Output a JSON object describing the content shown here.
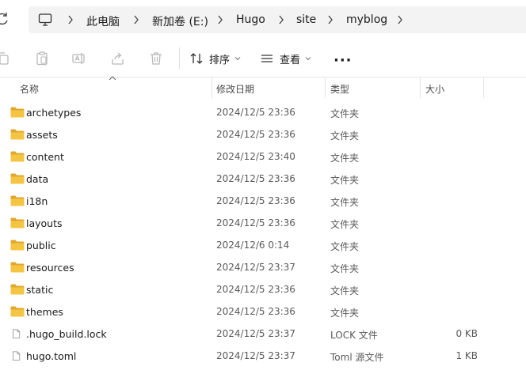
{
  "breadcrumb": [
    "此电脑",
    "新加卷 (E:)",
    "Hugo",
    "site",
    "myblog"
  ],
  "toolbar": {
    "sort_label": "排序",
    "view_label": "查看",
    "more_label": "···"
  },
  "columns": {
    "name": "名称",
    "date": "修改日期",
    "type": "类型",
    "size": "大小"
  },
  "files": [
    {
      "name": "archetypes",
      "date": "2024/12/5 23:36",
      "type": "文件夹",
      "size": "",
      "kind": "folder"
    },
    {
      "name": "assets",
      "date": "2024/12/5 23:36",
      "type": "文件夹",
      "size": "",
      "kind": "folder"
    },
    {
      "name": "content",
      "date": "2024/12/5 23:40",
      "type": "文件夹",
      "size": "",
      "kind": "folder"
    },
    {
      "name": "data",
      "date": "2024/12/5 23:36",
      "type": "文件夹",
      "size": "",
      "kind": "folder"
    },
    {
      "name": "i18n",
      "date": "2024/12/5 23:36",
      "type": "文件夹",
      "size": "",
      "kind": "folder"
    },
    {
      "name": "layouts",
      "date": "2024/12/5 23:36",
      "type": "文件夹",
      "size": "",
      "kind": "folder"
    },
    {
      "name": "public",
      "date": "2024/12/6 0:14",
      "type": "文件夹",
      "size": "",
      "kind": "folder"
    },
    {
      "name": "resources",
      "date": "2024/12/5 23:37",
      "type": "文件夹",
      "size": "",
      "kind": "folder"
    },
    {
      "name": "static",
      "date": "2024/12/5 23:36",
      "type": "文件夹",
      "size": "",
      "kind": "folder"
    },
    {
      "name": "themes",
      "date": "2024/12/5 23:36",
      "type": "文件夹",
      "size": "",
      "kind": "folder"
    },
    {
      "name": ".hugo_build.lock",
      "date": "2024/12/5 23:37",
      "type": "LOCK 文件",
      "size": "0 KB",
      "kind": "file"
    },
    {
      "name": "hugo.toml",
      "date": "2024/12/5 23:37",
      "type": "Toml 源文件",
      "size": "1 KB",
      "kind": "file"
    }
  ],
  "icons": {
    "folder_color": "#f4c542",
    "folder_dark": "#e0a82e"
  }
}
